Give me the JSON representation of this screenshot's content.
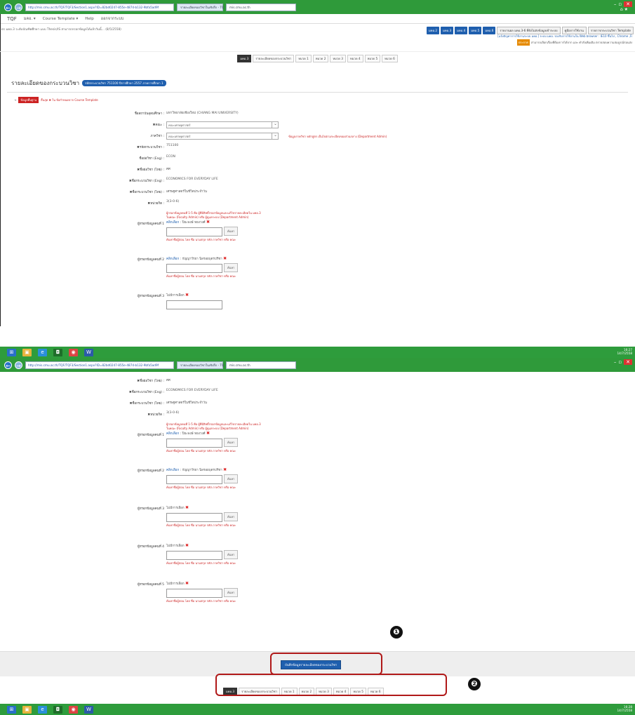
{
  "browser": {
    "address": "http://mis.cmu.ac.th/TQF/TQF3/Section1.aspx?ID=82bd0247-855e-4874-b132-9bfa5ad9f",
    "tab1": "รายละเอียดของวิชาในเชิงลึก - TQ",
    "tab2": "mis.cmu.ac.th",
    "min": "–",
    "max": "▫",
    "close": "✕",
    "favorites": "⌂ ★"
  },
  "menu": {
    "logo": "TQF",
    "items": [
      "มคอ. ▾",
      "Course Template ▾",
      "Help",
      "ออกจากระบบ"
    ]
  },
  "top": {
    "breadcrumb": "ตร มคอ.3 ระดับบัณฑิตศึกษา แบบ Thesis/IS สามารถกรอกข้อมูลได้แล้ววันนี้... (8/5/2558)",
    "buttons": [
      "มคอ.2",
      "มคอ.3",
      "มคอ.4",
      "มคอ.5",
      "มคอ.6"
    ],
    "white_buttons": [
      "รายงานผล มคอ.3-6 ที่ยังไม่ส่งข้อมูลเข้าระบบ",
      "คู่มือการใช้งาน",
      "รายการกระบวนวิชา Template"
    ],
    "note1": "[แจ้งปัญหาการใช้งานระบบ มคอ.] ระบบ มคอ. รองรับการใช้งานใน Web browser : IE10 ขึ้นไป , Chrome ,Fi",
    "note2_tag": "ประกาศ",
    "note2": "สามารถเลือกเรื่องที่ต้องการได้จาก และ คำสั่งเพิ่มเติม ตรวจสอบความสมบูรณ์ก่อนส่ง"
  },
  "sections": [
    "มคอ.3",
    "รายละเอียดของกระบวนวิชา",
    "หมวด 1",
    "หมวด 2",
    "หมวด 3",
    "หมวด 4",
    "หมวด 5",
    "หมวด 6"
  ],
  "heading": {
    "title": "รายละเอียดของกระบวนวิชา",
    "badge": "รหัสกระบวนวิชา 751100 ปีการศึกษา 2557 ภาคการศึกษา 1"
  },
  "tags": {
    "red_button": "ข้อมูลพื้นฐาน",
    "text": "สิ้นสุด ✖ ใน ข้อกำหนดจาก Course Template"
  },
  "form": {
    "university_label": "ชื่อสถาบันอุดมศึกษา :",
    "university": "มหาวิทยาลัยเชียงใหม่ (CHIANG MAI UNIVERSITY)",
    "faculty_label": "✖คณะ :",
    "faculty": "คณะเศรษฐศาสตร์",
    "dept_label": "ภาควิชา :",
    "dept": "คณะเศรษฐศาสตร์",
    "dept_hint": "ข้อมูลภาควิชา หลักสูตร เป็นไปตามระเบียบของส่วนกลาง (Department Admin)",
    "code_label": "✖รหัสกระบวนวิชา :",
    "code": "751100",
    "abbr_eng_label": "ชื่อย่อวิชา (Eng) :",
    "abbr_eng": "ECON",
    "abbr_th_label": "✖ชื่อย่อวิชา (ไทย) :",
    "abbr_th": "ศศ",
    "name_eng_label": "✖ชื่อกระบวนวิชา (Eng) :",
    "name_eng": "ECONOMICS FOR EVERYDAY LIFE",
    "name_th_label": "✖ชื่อกระบวนวิชา (ไทย) :",
    "name_th": "เศรษฐศาสตร์ในชีวิตประจำวัน",
    "credit_label": "✖หน่วยกิต :",
    "credit": "3(3-0-6)",
    "inst_hint1": "ผู้กรอกข้อมูลคนที่ 1-5 คือ ผู้ที่มีสิทธิ์กรอกข้อมูลและแก้ไขรายละเอียดใน มคอ.3",
    "inst_hint2": "ในคณะ (Faculty Admin) หรือ ผู้ดูแลระบบ (Department Admin)",
    "inst1_label": "ผู้กรอกข้อมูลคนที่ 1",
    "inst1_link": "คลิกเลือก",
    "inst1_name": "ปิยะพงษ์ ทองวงศ์",
    "inst2_label": "ผู้กรอกข้อมูลคนที่ 2",
    "inst2_link": "คลิกเลือก",
    "inst2_name": "กัญญาวีรยา นิลรอยบุตรปรีชา",
    "inst3_label": "ผู้กรอกข้อมูลคนที่ 3",
    "inst4_label": "ผู้กรอกข้อมูลคนที่ 4",
    "inst5_label": "ผู้กรอกข้อมูลคนที่ 5",
    "not_selected": "ไม่มีการเลือก",
    "search_btn": "ค้นหา",
    "search_hint": "ค้นหาชื่อผู้สอน โดย ชื่อ นามสกุล รหัส ภาควิชา หรือ คณะ"
  },
  "save_button": "บันทึกข้อมูลรายละเอียดของกระบวนวิชา",
  "callout1": "❶",
  "callout2": "❷",
  "taskbar": {
    "icons": [
      "⊞",
      "▣",
      "e",
      "◘",
      "◉",
      "W"
    ],
    "tray": "16:27\n14/7/2558",
    "tray2": "16:28\n14/7/2558"
  }
}
